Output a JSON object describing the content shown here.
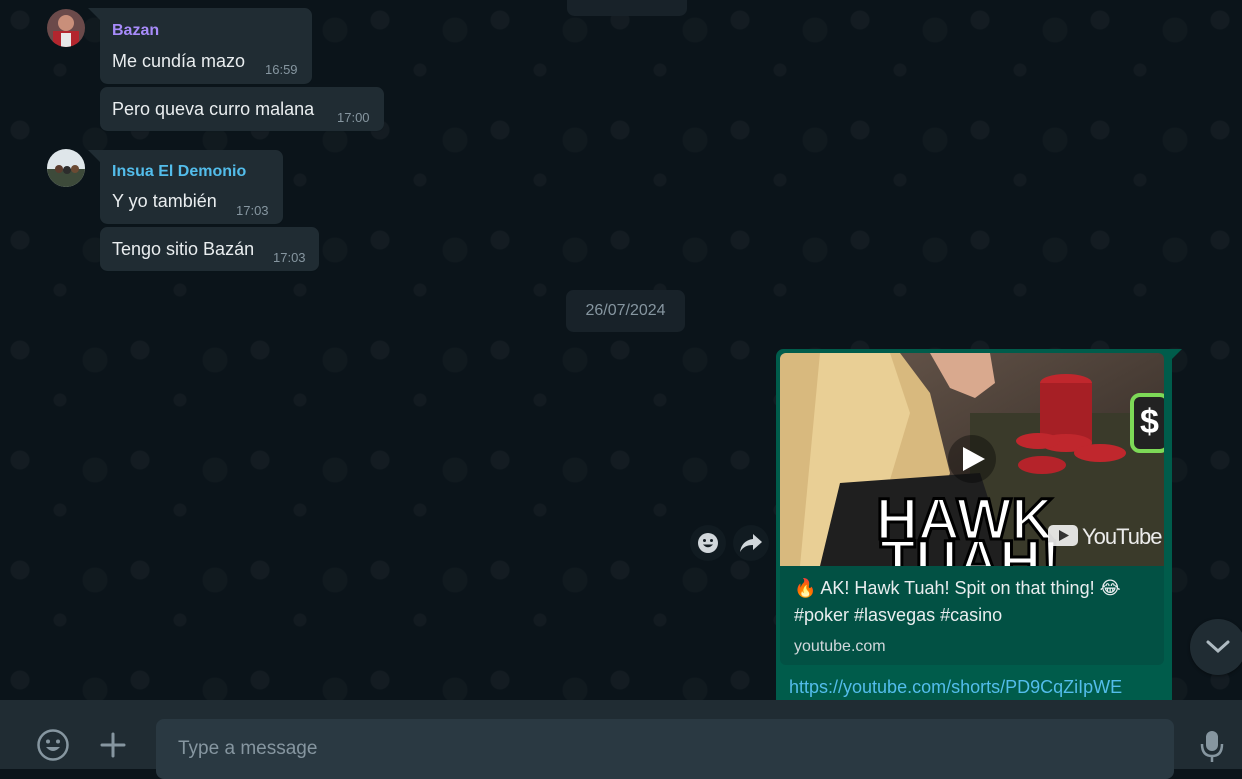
{
  "messages": [
    {
      "sender": "Bazan",
      "sender_color": "#a78bfa",
      "text": "Me cundía mazo",
      "time": "16:59"
    },
    {
      "text": "Pero queva curro malana",
      "time": "17:00"
    },
    {
      "sender": "Insua El Demonio",
      "sender_color": "#53bdeb",
      "text": "Y yo también",
      "time": "17:03"
    },
    {
      "text": "Tengo sitio Bazán",
      "time": "17:03"
    }
  ],
  "date_separator": "26/07/2024",
  "outgoing": {
    "preview_title": "🔥 AK! Hawk Tuah! Spit on that thing! 😂 #poker #lasvegas #casino",
    "preview_domain": "youtube.com",
    "link": "https://youtube.com/shorts/PD9CqZiIpWE",
    "thumb_overlay_text": "HAWK TUAH!",
    "thumb_brand": "YouTube"
  },
  "composer": {
    "placeholder": "Type a message"
  },
  "colors": {
    "background": "#0b141a",
    "incoming_bubble": "#202c33",
    "outgoing_bubble": "#005c4b",
    "link": "#53bdeb"
  }
}
